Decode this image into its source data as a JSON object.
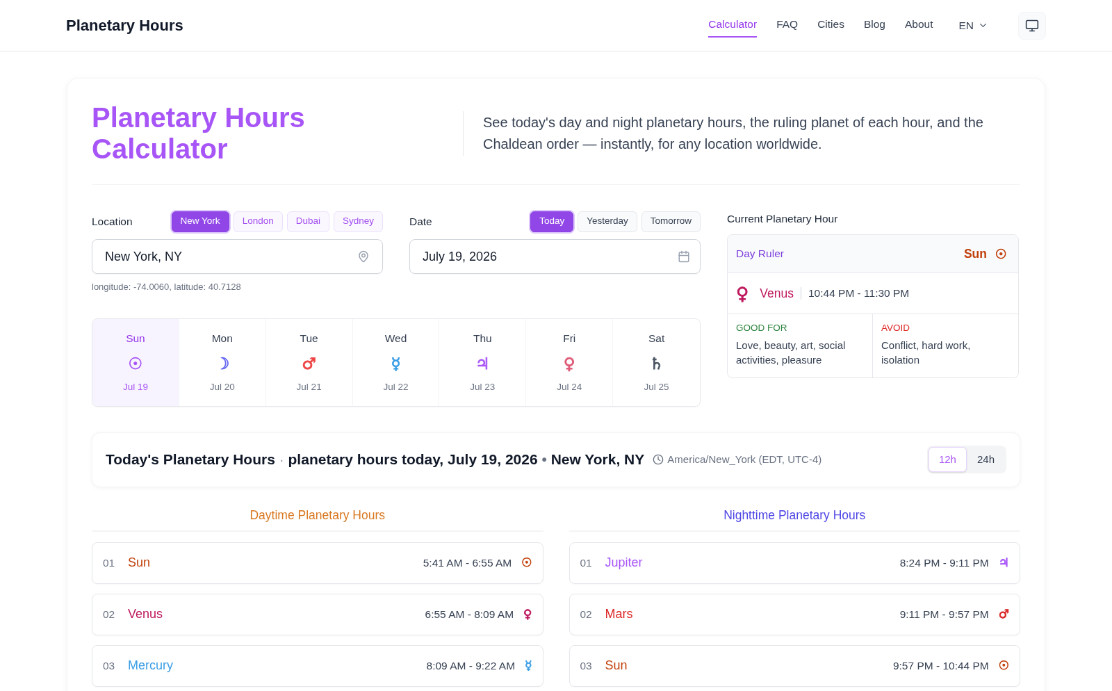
{
  "header": {
    "logo": "Planetary Hours",
    "nav": [
      {
        "label": "Calculator",
        "selected": true
      },
      {
        "label": "FAQ",
        "selected": false
      },
      {
        "label": "Cities",
        "selected": false
      },
      {
        "label": "Blog",
        "selected": false
      },
      {
        "label": "About",
        "selected": false
      }
    ],
    "language": "EN"
  },
  "hero": {
    "title": "Planetary Hours Calculator",
    "description": "See today's day and night planetary hours, the ruling planet of each hour, and the Chaldean order — instantly, for any location worldwide."
  },
  "location": {
    "label": "Location",
    "presets": [
      {
        "label": "New York",
        "selected": true
      },
      {
        "label": "London",
        "selected": false
      },
      {
        "label": "Dubai",
        "selected": false
      },
      {
        "label": "Sydney",
        "selected": false
      }
    ],
    "value": "New York, NY",
    "coordinates": "longitude: -74.0060, latitude: 40.7128"
  },
  "date": {
    "label": "Date",
    "presets": [
      {
        "label": "Today",
        "selected": true
      },
      {
        "label": "Yesterday",
        "selected": false
      },
      {
        "label": "Tomorrow",
        "selected": false
      }
    ],
    "value": "July 19, 2026"
  },
  "week": [
    {
      "day": "Sun",
      "symbol": "☉",
      "date": "Jul 19",
      "color": "#a855f7",
      "selected": true
    },
    {
      "day": "Mon",
      "symbol": "☽",
      "date": "Jul 20",
      "color": "#6366f1",
      "selected": false
    },
    {
      "day": "Tue",
      "symbol": "♂",
      "date": "Jul 21",
      "color": "#ef4444",
      "selected": false
    },
    {
      "day": "Wed",
      "symbol": "☿",
      "date": "Jul 22",
      "color": "#3b9ee6",
      "selected": false
    },
    {
      "day": "Thu",
      "symbol": "♃",
      "date": "Jul 23",
      "color": "#a855f7",
      "selected": false
    },
    {
      "day": "Fri",
      "symbol": "♀",
      "date": "Jul 24",
      "color": "#e05a78",
      "selected": false
    },
    {
      "day": "Sat",
      "symbol": "♄",
      "date": "Jul 25",
      "color": "#4b5563",
      "selected": false
    }
  ],
  "current_hour": {
    "label": "Current Planetary Hour",
    "day_ruler": {
      "label": "Day Ruler",
      "planet": "Sun",
      "symbol": "☉",
      "color": "#c2410c"
    },
    "hour": {
      "symbol": "♀",
      "planet": "Venus",
      "time": "10:44 PM - 11:30 PM",
      "color": "#be185d"
    },
    "good_for": {
      "label": "GOOD FOR",
      "text": "Love, beauty, art, social activities, pleasure"
    },
    "avoid": {
      "label": "AVOID",
      "text": "Conflict, hard work, isolation"
    }
  },
  "schedule": {
    "title": "Today's Planetary Hours",
    "separator_1": "·",
    "subtitle": "planetary hours today, July 19, 2026",
    "separator_2": "•",
    "place": "New York, NY",
    "timezone": "America/New_York (EDT, UTC-4)",
    "formats": [
      {
        "label": "12h",
        "selected": true
      },
      {
        "label": "24h",
        "selected": false
      }
    ]
  },
  "daytime": {
    "heading": "Daytime Planetary Hours",
    "hours": [
      {
        "number": "01",
        "planet": "Sun",
        "time": "5:41 AM - 6:55 AM",
        "symbol": "☉",
        "color": "#c2410c"
      },
      {
        "number": "02",
        "planet": "Venus",
        "time": "6:55 AM - 8:09 AM",
        "symbol": "♀",
        "color": "#be185d"
      },
      {
        "number": "03",
        "planet": "Mercury",
        "time": "8:09 AM - 9:22 AM",
        "symbol": "☿",
        "color": "#3b9ee6"
      }
    ]
  },
  "nighttime": {
    "heading": "Nighttime Planetary Hours",
    "hours": [
      {
        "number": "01",
        "planet": "Jupiter",
        "time": "8:24 PM - 9:11 PM",
        "symbol": "♃",
        "color": "#a855f7"
      },
      {
        "number": "02",
        "planet": "Mars",
        "time": "9:11 PM - 9:57 PM",
        "symbol": "♂",
        "color": "#dc2626"
      },
      {
        "number": "03",
        "planet": "Sun",
        "time": "9:57 PM - 10:44 PM",
        "symbol": "☉",
        "color": "#c2410c"
      }
    ]
  }
}
